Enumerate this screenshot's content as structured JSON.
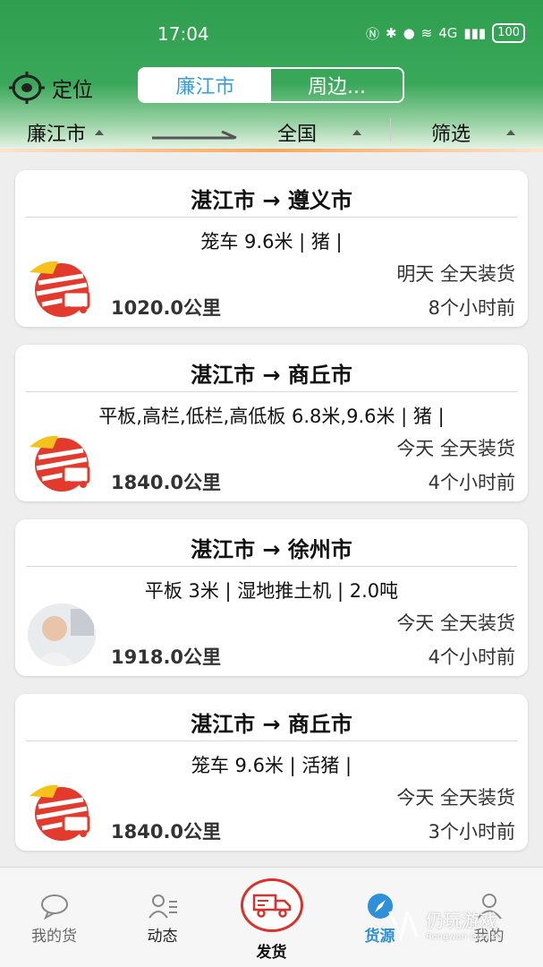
{
  "status_bar": {
    "time": "17:04",
    "network": "4G",
    "battery": "100"
  },
  "header": {
    "locate_label": "定位",
    "tabs": [
      {
        "label": "廉江市",
        "active": true
      },
      {
        "label": "周边...",
        "active": false
      }
    ]
  },
  "filter": {
    "from": "廉江市",
    "to": "全国",
    "filter_label": "筛选"
  },
  "colors": {
    "header_green": "#2f9e4f",
    "accent_blue": "#3a9bd8",
    "ship_red": "#d9312b"
  },
  "cards": [
    {
      "title": "湛江市 → 遵义市",
      "spec": "笼车 9.6米 | 猪 |",
      "load": "明天 全天装货",
      "distance": "1020.0公里",
      "time": "8个小时前",
      "avatar": "logo-icon"
    },
    {
      "title": "湛江市 → 商丘市",
      "spec": "平板,高栏,低栏,高低板 6.8米,9.6米 | 猪 |",
      "load": "今天 全天装货",
      "distance": "1840.0公里",
      "time": "4个小时前",
      "avatar": "logo-icon"
    },
    {
      "title": "湛江市 → 徐州市",
      "spec": "平板 3米 | 湿地推土机 | 2.0吨",
      "load": "今天 全天装货",
      "distance": "1918.0公里",
      "time": "4个小时前",
      "avatar": "photo"
    },
    {
      "title": "湛江市 → 商丘市",
      "spec": "笼车 9.6米 | 活猪 |",
      "load": "今天 全天装货",
      "distance": "1840.0公里",
      "time": "3个小时前",
      "avatar": "logo-icon"
    }
  ],
  "bottom_nav": [
    {
      "label": "我的货",
      "icon": "chat-icon",
      "active": false
    },
    {
      "label": "动态",
      "icon": "users-list-icon",
      "active": false
    },
    {
      "label": "发货",
      "icon": "truck-icon",
      "active": false
    },
    {
      "label": "货源",
      "icon": "compass-icon",
      "active": true
    },
    {
      "label": "我的",
      "icon": "user-icon",
      "active": false
    }
  ],
  "watermark": {
    "text": "仍玩游戏",
    "sub": "Rengwan Games"
  }
}
